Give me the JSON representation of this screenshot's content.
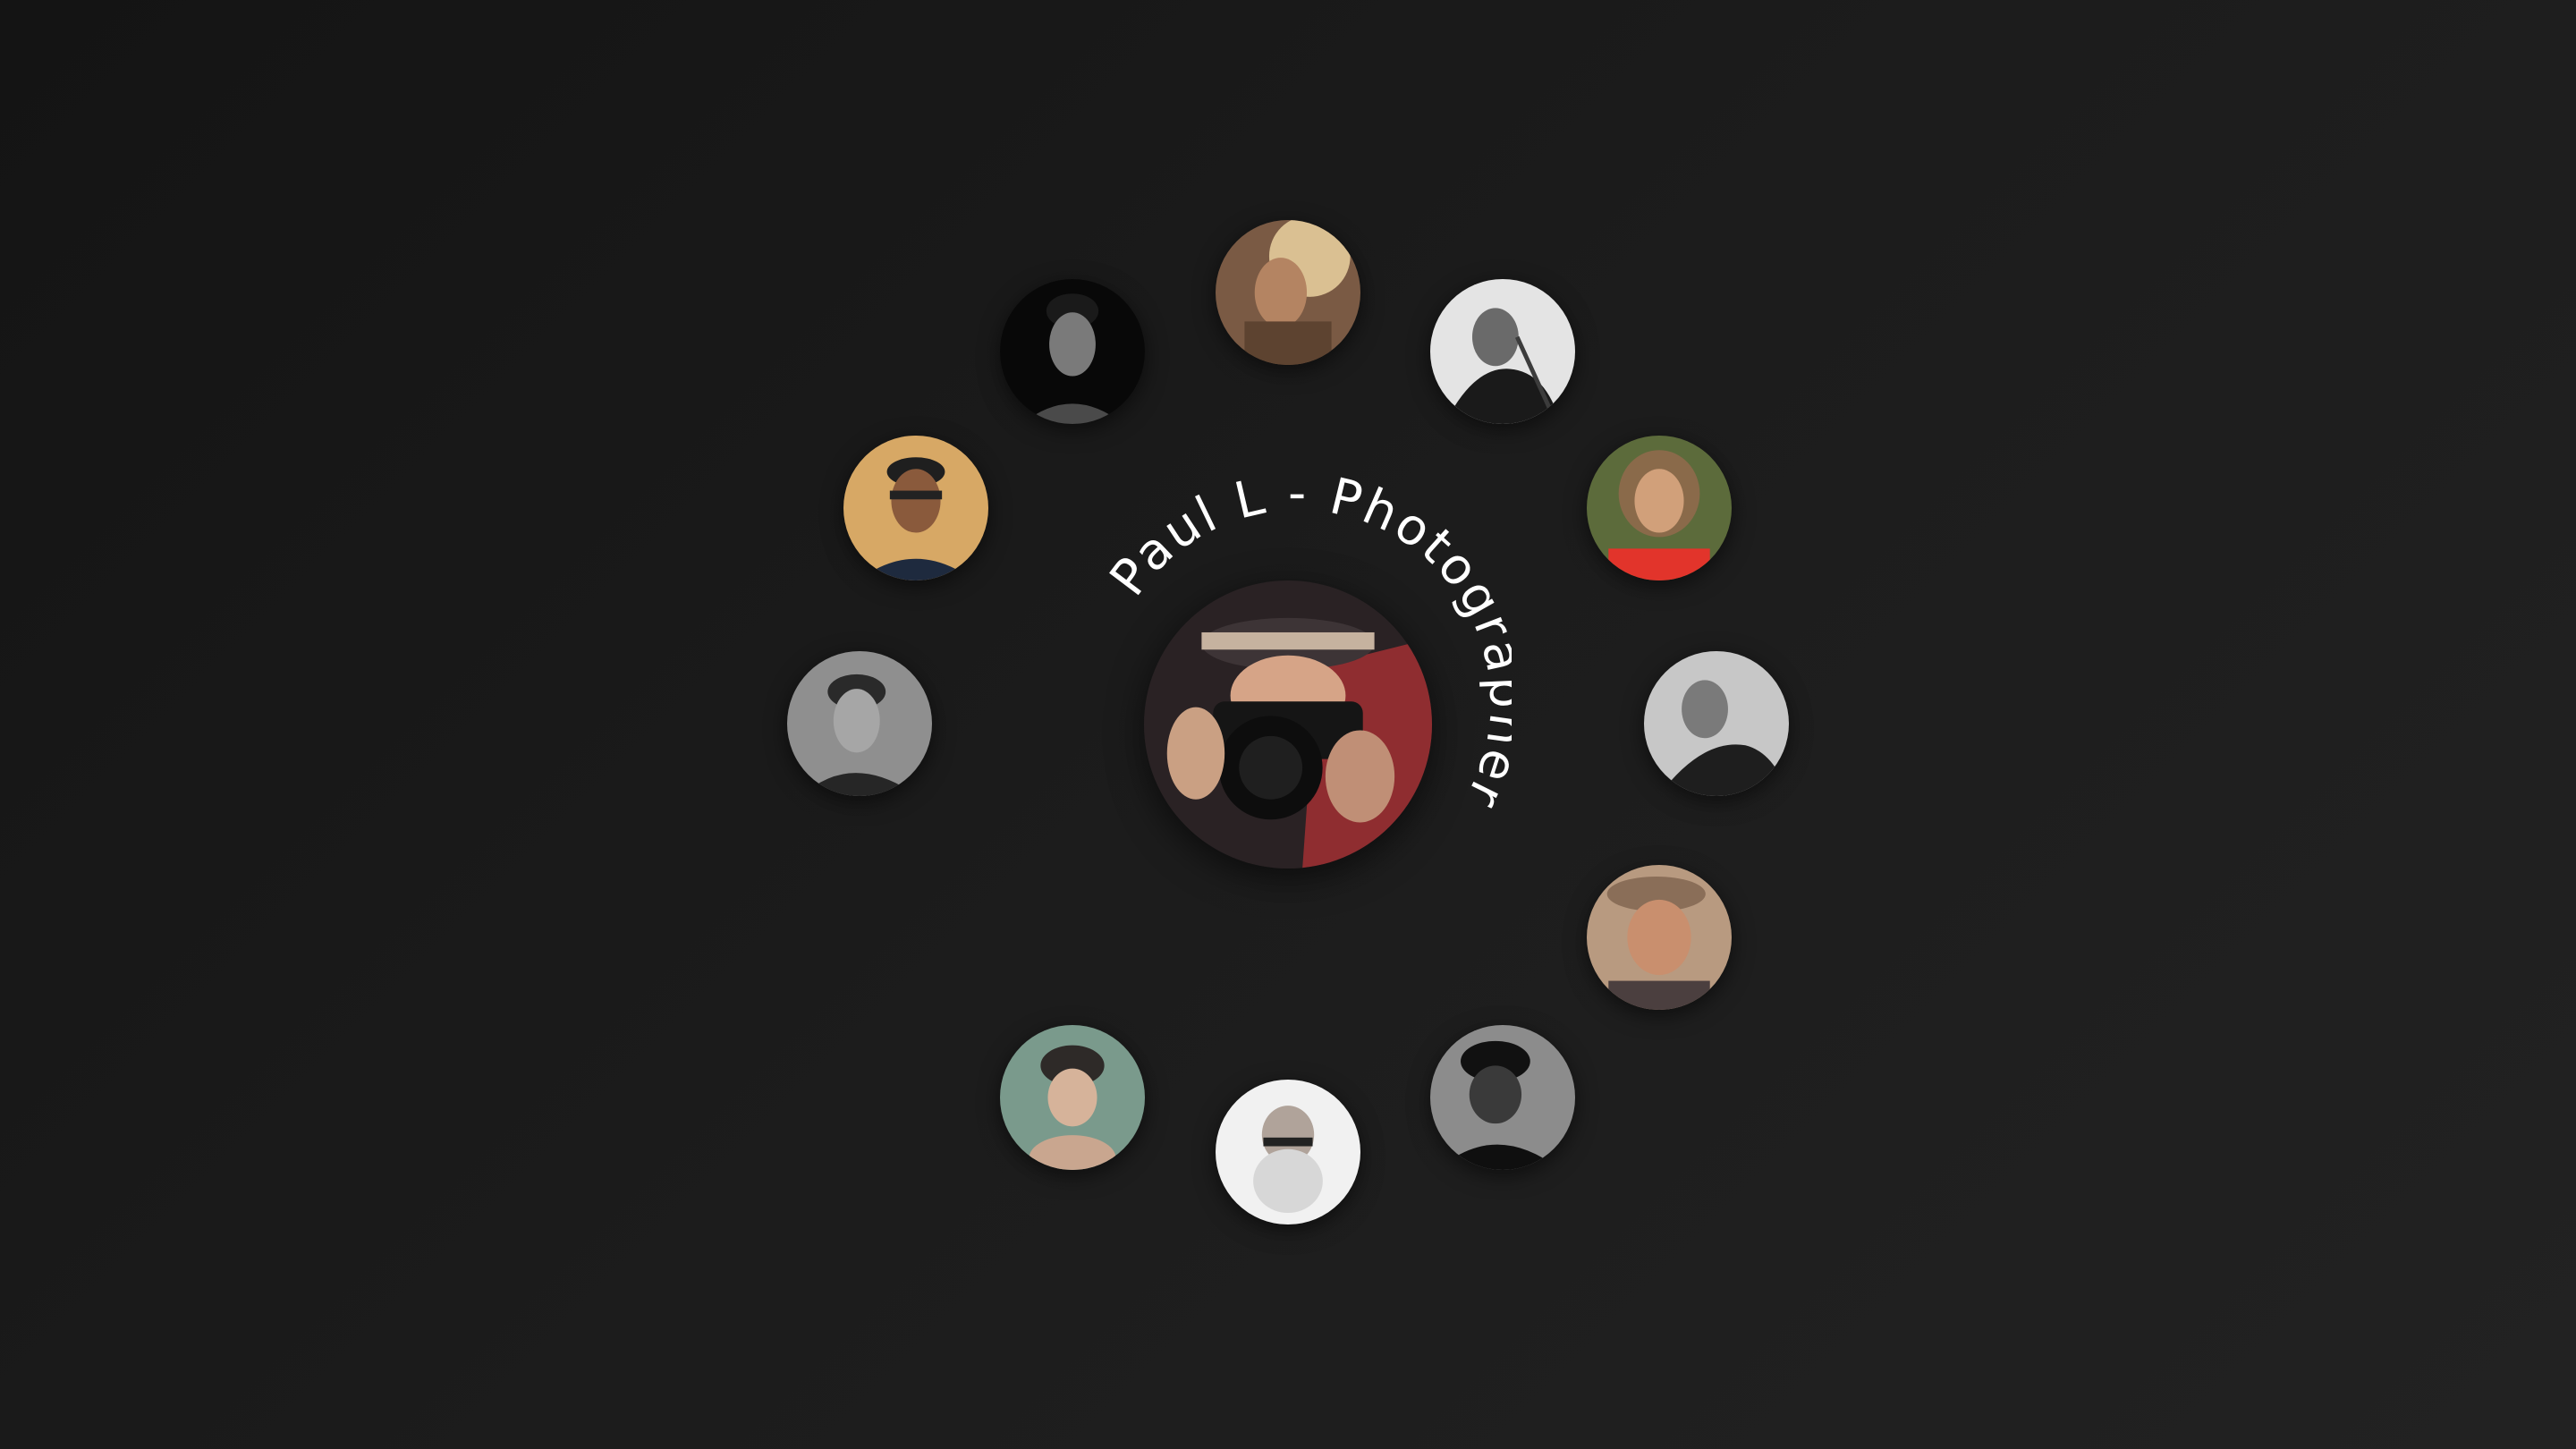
{
  "profile": {
    "title": "Paul L - Photographer"
  },
  "avatars": [
    {
      "name": "avatar-top",
      "palette": [
        "#c9a27a",
        "#6f5440",
        "#3b2c22"
      ]
    },
    {
      "name": "avatar-top-right",
      "palette": [
        "#d8d8d8",
        "#3c3c3c",
        "#121212"
      ]
    },
    {
      "name": "avatar-right-upper",
      "palette": [
        "#5c6b3b",
        "#d1a07a",
        "#e2342b"
      ]
    },
    {
      "name": "avatar-right",
      "palette": [
        "#bdbdbd",
        "#4a4a4a",
        "#1a1a1a"
      ]
    },
    {
      "name": "avatar-right-lower",
      "palette": [
        "#c8a98a",
        "#a86b52",
        "#5d4a42"
      ]
    },
    {
      "name": "avatar-bottom-right",
      "palette": [
        "#9a9a9a",
        "#2c2c2c",
        "#0d0d0d"
      ]
    },
    {
      "name": "avatar-bottom",
      "palette": [
        "#efefef",
        "#bcbcbc",
        "#6a6a6a"
      ]
    },
    {
      "name": "avatar-bottom-left",
      "palette": [
        "#7a9a8c",
        "#d6b39a",
        "#2e2a28"
      ]
    },
    {
      "name": "avatar-left",
      "palette": [
        "#a8a8a8",
        "#505050",
        "#1a1a1a"
      ]
    },
    {
      "name": "avatar-left-upper",
      "palette": [
        "#e0b36a",
        "#8a5a3c",
        "#1e2a3e"
      ]
    },
    {
      "name": "avatar-top-left",
      "palette": [
        "#9a9a9a",
        "#303030",
        "#050505"
      ]
    }
  ],
  "center": {
    "palette": [
      "#3b2a2e",
      "#b23a3a",
      "#1a1a1a",
      "#d9a98a"
    ]
  }
}
